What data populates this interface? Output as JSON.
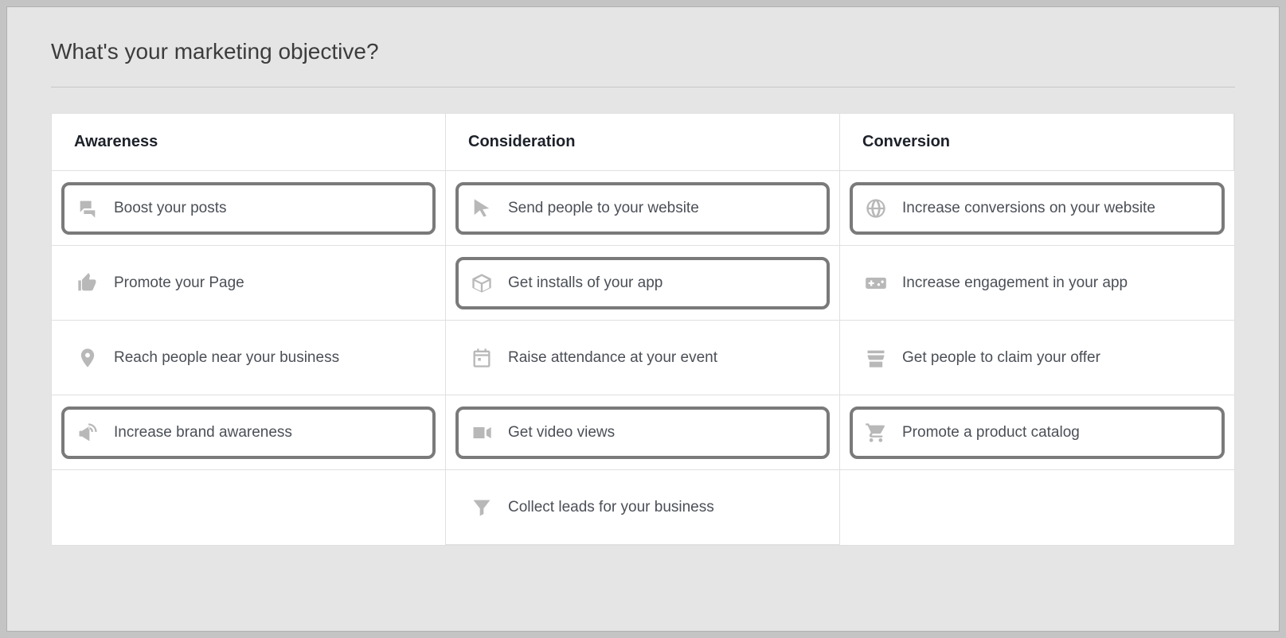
{
  "title": "What's your marketing objective?",
  "columns": [
    {
      "header": "Awareness"
    },
    {
      "header": "Consideration"
    },
    {
      "header": "Conversion"
    }
  ],
  "objectives": {
    "awareness": [
      {
        "label": "Boost your posts",
        "icon": "comments-icon",
        "highlighted": true
      },
      {
        "label": "Promote your Page",
        "icon": "thumbs-up-icon",
        "highlighted": false
      },
      {
        "label": "Reach people near your business",
        "icon": "map-pin-icon",
        "highlighted": false
      },
      {
        "label": "Increase brand awareness",
        "icon": "megaphone-icon",
        "highlighted": true
      }
    ],
    "consideration": [
      {
        "label": "Send people to your website",
        "icon": "cursor-icon",
        "highlighted": true
      },
      {
        "label": "Get installs of your app",
        "icon": "box-icon",
        "highlighted": true
      },
      {
        "label": "Raise attendance at your event",
        "icon": "calendar-icon",
        "highlighted": false
      },
      {
        "label": "Get video views",
        "icon": "video-icon",
        "highlighted": true
      },
      {
        "label": "Collect leads for your business",
        "icon": "funnel-icon",
        "highlighted": false
      }
    ],
    "conversion": [
      {
        "label": "Increase conversions on your website",
        "icon": "globe-icon",
        "highlighted": true
      },
      {
        "label": "Increase engagement in your app",
        "icon": "gamepad-icon",
        "highlighted": false
      },
      {
        "label": "Get people to claim your offer",
        "icon": "storefront-icon",
        "highlighted": false
      },
      {
        "label": "Promote a product catalog",
        "icon": "shopping-cart-icon",
        "highlighted": true
      }
    ]
  }
}
